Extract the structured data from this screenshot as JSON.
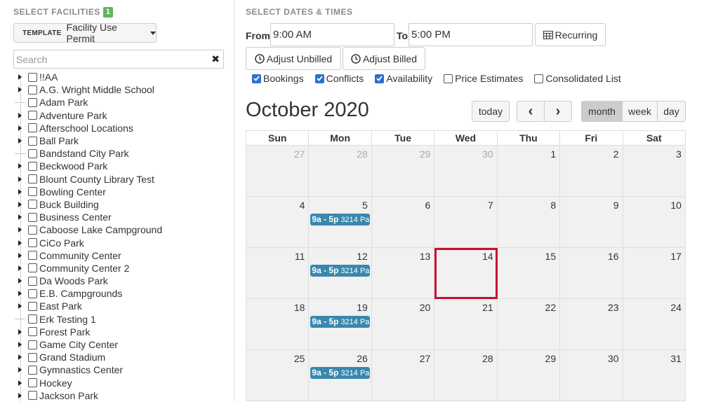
{
  "facilities": {
    "title": "SELECT FACILITIES",
    "count": "1",
    "template_tag": "TEMPLATE",
    "template_value": "Facility Use Permit",
    "search_placeholder": "Search",
    "clear_glyph": "✖",
    "items": [
      {
        "label": "!!AA",
        "expandable": true
      },
      {
        "label": "A.G. Wright Middle School",
        "expandable": true
      },
      {
        "label": "Adam Park",
        "expandable": false
      },
      {
        "label": "Adventure Park",
        "expandable": true
      },
      {
        "label": "Afterschool Locations",
        "expandable": true
      },
      {
        "label": "Ball Park",
        "expandable": true
      },
      {
        "label": "Bandstand City Park",
        "expandable": false
      },
      {
        "label": "Beckwood Park",
        "expandable": true
      },
      {
        "label": "Blount County Library Test",
        "expandable": true
      },
      {
        "label": "Bowling Center",
        "expandable": true
      },
      {
        "label": "Buck Building",
        "expandable": true
      },
      {
        "label": "Business Center",
        "expandable": true
      },
      {
        "label": "Caboose Lake Campground",
        "expandable": true
      },
      {
        "label": "CiCo Park",
        "expandable": true
      },
      {
        "label": "Community Center",
        "expandable": true
      },
      {
        "label": "Community Center 2",
        "expandable": true
      },
      {
        "label": "Da Woods Park",
        "expandable": true
      },
      {
        "label": "E.B. Campgrounds",
        "expandable": true
      },
      {
        "label": "East Park",
        "expandable": true
      },
      {
        "label": "Erk Testing 1",
        "expandable": false
      },
      {
        "label": "Forest Park",
        "expandable": true
      },
      {
        "label": "Game City Center",
        "expandable": true
      },
      {
        "label": "Grand Stadium",
        "expandable": true
      },
      {
        "label": "Gymnastics Center",
        "expandable": true
      },
      {
        "label": "Hockey",
        "expandable": true
      },
      {
        "label": "Jackson Park",
        "expandable": true
      }
    ]
  },
  "dates": {
    "title": "SELECT DATES & TIMES",
    "from_label": "From",
    "from_value": "9:00 AM",
    "to_label": "To",
    "to_value": "5:00 PM",
    "recurring_label": "Recurring",
    "adjust_unbilled_label": "Adjust Unbilled",
    "adjust_billed_label": "Adjust Billed",
    "checkboxes": [
      {
        "label": "Bookings",
        "checked": true
      },
      {
        "label": "Conflicts",
        "checked": true
      },
      {
        "label": "Availability",
        "checked": true
      },
      {
        "label": "Price Estimates",
        "checked": false
      },
      {
        "label": "Consolidated List",
        "checked": false
      }
    ]
  },
  "calendar": {
    "title": "October 2020",
    "today_label": "today",
    "prev_glyph": "‹",
    "next_glyph": "›",
    "views": [
      "month",
      "week",
      "day"
    ],
    "active_view": "month",
    "day_headers": [
      "Sun",
      "Mon",
      "Tue",
      "Wed",
      "Thu",
      "Fri",
      "Sat"
    ],
    "weeks": [
      [
        "27",
        "28",
        "29",
        "30",
        "1",
        "2",
        "3"
      ],
      [
        "4",
        "5",
        "6",
        "7",
        "8",
        "9",
        "10"
      ],
      [
        "11",
        "12",
        "13",
        "14",
        "15",
        "16",
        "17"
      ],
      [
        "18",
        "19",
        "20",
        "21",
        "22",
        "23",
        "24"
      ],
      [
        "25",
        "26",
        "27",
        "28",
        "29",
        "30",
        "31"
      ]
    ],
    "other_month_first_week_count": 4,
    "highlight_day": "14",
    "event": {
      "time": "9a - 5p",
      "title": "3214 Pa",
      "weekday_index": 1,
      "weeks": [
        1,
        2,
        3,
        4
      ]
    },
    "colors": {
      "event": "#3a87ad",
      "highlight": "#c8102e",
      "checkbox": "#2f6fd0",
      "badge": "#5cb85c"
    }
  }
}
